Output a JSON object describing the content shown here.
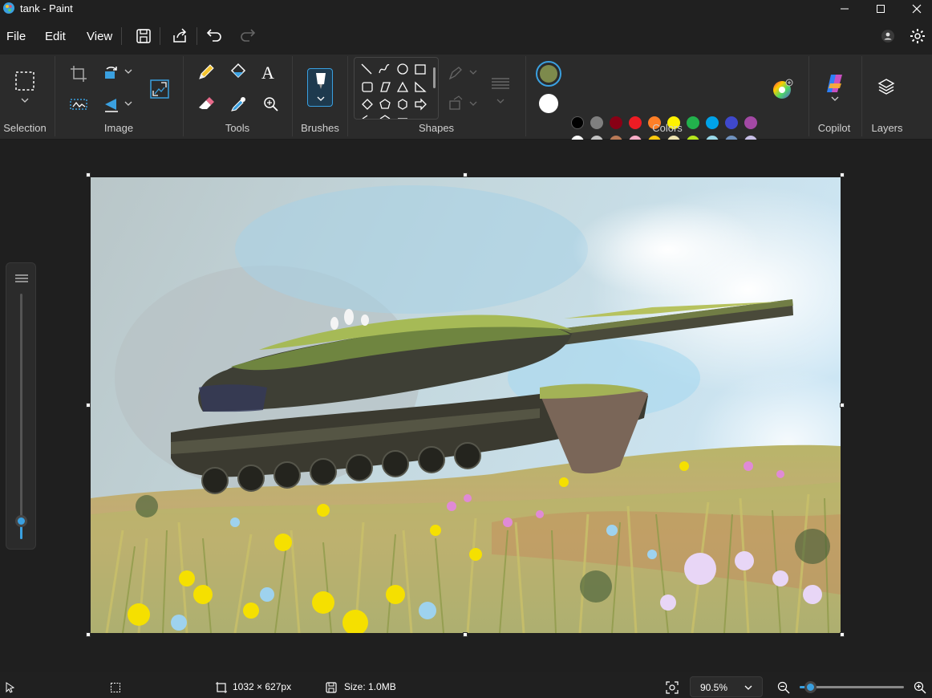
{
  "window": {
    "title": "tank - Paint"
  },
  "menu": {
    "file": "File",
    "edit": "Edit",
    "view": "View"
  },
  "ribbon": {
    "groups": {
      "selection": "Selection",
      "image": "Image",
      "tools": "Tools",
      "brushes": "Brushes",
      "shapes": "Shapes",
      "colors": "Colors",
      "copilot": "Copilot",
      "layers": "Layers"
    },
    "text_tool_glyph": "A"
  },
  "colors": {
    "primary": "#7d8a4c",
    "secondary": "#ffffff",
    "palette": [
      [
        "#000000",
        "#7f7f7f",
        "#880015",
        "#ed1c24",
        "#ff7f27",
        "#fff200",
        "#22b14c",
        "#00a2e8",
        "#3f48cc",
        "#a349a4"
      ],
      [
        "#ffffff",
        "#c3c3c3",
        "#b97a57",
        "#ffaec9",
        "#ffc90e",
        "#efe4b0",
        "#b5e61d",
        "#99d9ea",
        "#7092be",
        "#c8bfe7"
      ],
      [
        "#dce8a0",
        "#d4dd6c",
        "#c4c87a",
        "#2a2e22",
        "#181a14",
        "#4c5a3c",
        "#2f3e36",
        "#6e7a42",
        "#d8ac90",
        "#8fb4f0"
      ]
    ]
  },
  "status": {
    "dimensions": "1032 × 627px",
    "size": "Size: 1.0MB",
    "zoom": "90.5%",
    "zoom_fraction": 0.1
  }
}
